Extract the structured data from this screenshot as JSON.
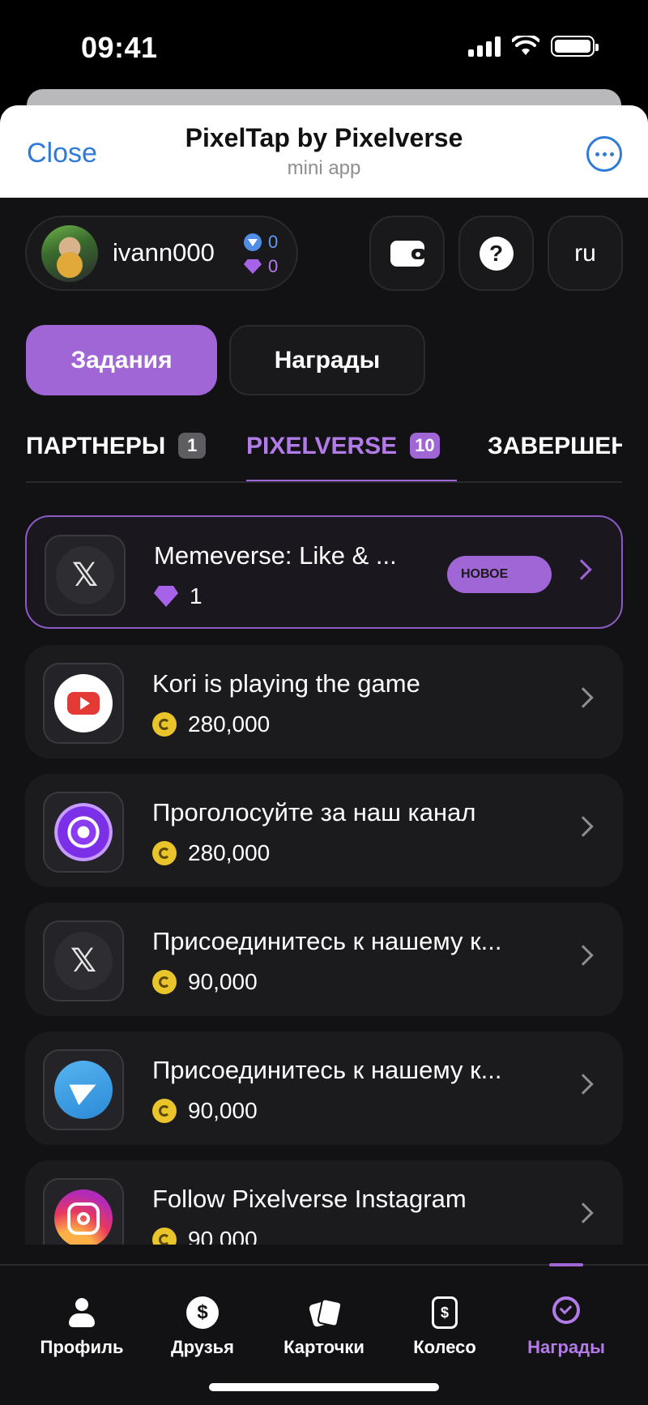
{
  "status_bar": {
    "time": "09:41"
  },
  "telegram_header": {
    "close_label": "Close",
    "title": "PixelTap by Pixelverse",
    "subtitle": "mini app"
  },
  "user": {
    "username": "ivann000",
    "ton_balance": "0",
    "gem_balance": "0",
    "language": "ru"
  },
  "segments": {
    "tasks_label": "Задания",
    "rewards_label": "Награды",
    "active": "tasks"
  },
  "categories": [
    {
      "label": "ПАРТНЕРЫ",
      "count": "1"
    },
    {
      "label": "PIXELVERSE",
      "count": "10",
      "active": true
    },
    {
      "label": "ЗАВЕРШЕН"
    }
  ],
  "tasks": [
    {
      "title": "Memeverse: Like & ...",
      "reward": "1",
      "reward_type": "gem",
      "badge": "НОВОЕ",
      "icon": "x-icon",
      "highlight": true
    },
    {
      "title": "Kori is playing the game",
      "reward": "280,000",
      "reward_type": "coin",
      "icon": "youtube-icon"
    },
    {
      "title": "Проголосуйте за наш канал",
      "reward": "280,000",
      "reward_type": "coin",
      "icon": "pixelverse-swirl-icon"
    },
    {
      "title": "Присоединитесь к нашему к...",
      "reward": "90,000",
      "reward_type": "coin",
      "icon": "x-icon"
    },
    {
      "title": "Присоединитесь к нашему к...",
      "reward": "90,000",
      "reward_type": "coin",
      "icon": "telegram-icon"
    },
    {
      "title": "Follow Pixelverse Instagram",
      "reward": "90,000",
      "reward_type": "coin",
      "icon": "instagram-icon"
    }
  ],
  "bottom_nav": [
    {
      "label": "Профиль",
      "icon": "profile-icon"
    },
    {
      "label": "Друзья",
      "icon": "dollar-icon"
    },
    {
      "label": "Карточки",
      "icon": "cards-icon"
    },
    {
      "label": "Колесо",
      "icon": "wheel-icon"
    },
    {
      "label": "Награды",
      "icon": "rewards-icon",
      "active": true
    }
  ],
  "colors": {
    "accent": "#a066d6",
    "background": "#121214",
    "link_blue": "#2f7bd8"
  }
}
